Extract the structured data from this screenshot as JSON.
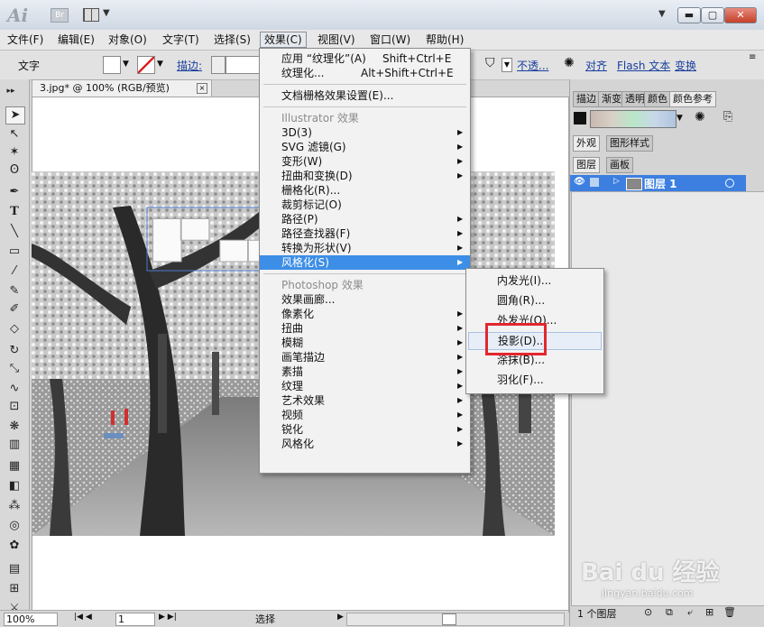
{
  "titlebar": {
    "app_logo": "Ai",
    "bridge_logo": "Br",
    "minimize": "▬",
    "maximize": "▢",
    "close": "✕"
  },
  "menubar": [
    "文件(F)",
    "编辑(E)",
    "对象(O)",
    "文字(T)",
    "选择(S)",
    "效果(C)",
    "视图(V)",
    "窗口(W)",
    "帮助(H)"
  ],
  "controlbar": {
    "tool_label": "文字",
    "stroke_label": "描边:",
    "opacity_label": "不透...",
    "align_label": "对齐",
    "flash_text_label": "Flash 文本",
    "transform_label": "变换"
  },
  "document": {
    "tab_title": "3.jpg* @ 100% (RGB/预览)",
    "close": "×"
  },
  "effect_menu": {
    "items": [
      {
        "label": "应用 “纹理化”(A)",
        "shortcut": "Shift+Ctrl+E",
        "type": "item"
      },
      {
        "label": "纹理化...",
        "shortcut": "Alt+Shift+Ctrl+E",
        "type": "item"
      },
      {
        "type": "sep"
      },
      {
        "label": "文档栅格效果设置(E)...",
        "type": "item"
      },
      {
        "type": "sep"
      },
      {
        "label": "Illustrator 效果",
        "type": "header"
      },
      {
        "label": "3D(3)",
        "type": "sub"
      },
      {
        "label": "SVG 滤镜(G)",
        "type": "sub"
      },
      {
        "label": "变形(W)",
        "type": "sub"
      },
      {
        "label": "扭曲和变换(D)",
        "type": "sub"
      },
      {
        "label": "栅格化(R)...",
        "type": "item"
      },
      {
        "label": "裁剪标记(O)",
        "type": "item"
      },
      {
        "label": "路径(P)",
        "type": "sub"
      },
      {
        "label": "路径查找器(F)",
        "type": "sub"
      },
      {
        "label": "转换为形状(V)",
        "type": "sub"
      },
      {
        "label": "风格化(S)",
        "type": "sub",
        "highlight": true
      },
      {
        "type": "sep"
      },
      {
        "label": "Photoshop 效果",
        "type": "header"
      },
      {
        "label": "效果画廊...",
        "type": "item"
      },
      {
        "label": "像素化",
        "type": "sub"
      },
      {
        "label": "扭曲",
        "type": "sub"
      },
      {
        "label": "模糊",
        "type": "sub"
      },
      {
        "label": "画笔描边",
        "type": "sub"
      },
      {
        "label": "素描",
        "type": "sub"
      },
      {
        "label": "纹理",
        "type": "sub"
      },
      {
        "label": "艺术效果",
        "type": "sub"
      },
      {
        "label": "视频",
        "type": "sub"
      },
      {
        "label": "锐化",
        "type": "sub"
      },
      {
        "label": "风格化",
        "type": "sub"
      }
    ]
  },
  "stylize_submenu": [
    {
      "label": "内发光(I)..."
    },
    {
      "label": "圆角(R)..."
    },
    {
      "label": "外发光(O)..."
    },
    {
      "label": "投影(D)...",
      "hover": true
    },
    {
      "label": "涂抹(B)..."
    },
    {
      "label": "羽化(F)..."
    }
  ],
  "panels": {
    "top_tabs": [
      "描边",
      "渐变",
      "透明",
      "颜色",
      "颜色参考"
    ],
    "tabs2": [
      "外观",
      "图形样式"
    ],
    "tabs3": [
      "图层",
      "画板"
    ],
    "layer_name": "图层 1",
    "footer_count": "1 个图层"
  },
  "statusbar": {
    "zoom": "100%",
    "page": "1",
    "status_text": "选择"
  },
  "watermark": {
    "main": "Bai du 经验",
    "sub": "jingyan.baidu.com"
  },
  "colors": {
    "highlight": "#3d8ee6",
    "red_box": "#e3262e",
    "layer_select": "#3c7fe0"
  }
}
